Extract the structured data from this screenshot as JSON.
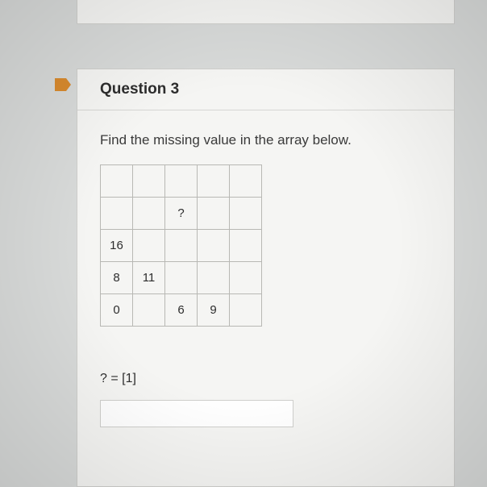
{
  "question": {
    "title": "Question 3",
    "prompt": "Find the missing value in the array below.",
    "grid": [
      [
        "",
        "",
        "",
        "",
        ""
      ],
      [
        "",
        "",
        "?",
        "",
        ""
      ],
      [
        "16",
        "",
        "",
        "",
        ""
      ],
      [
        "8",
        "11",
        "",
        "",
        ""
      ],
      [
        "0",
        "",
        "6",
        "9",
        ""
      ]
    ],
    "answer_label": "? = [1]",
    "answer_value": ""
  },
  "icons": {
    "bookmark": "bookmark-icon"
  }
}
